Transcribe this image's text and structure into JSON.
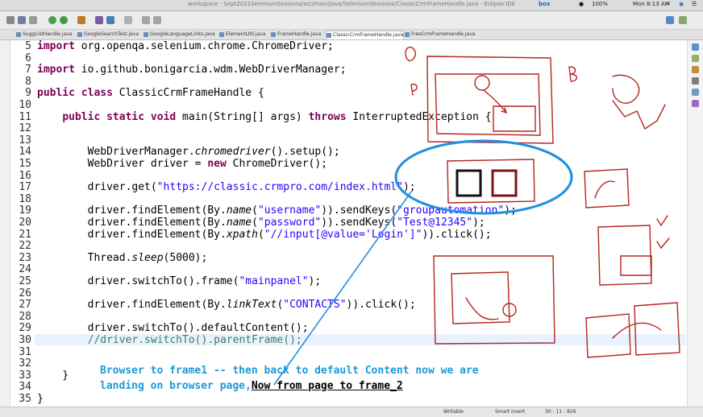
{
  "window": {
    "title": "workspace - Sept2021SeleniumSessions/src/main/java/SeleniumSessions/ClassicCrmFrameHandle.java - Eclipse IDE",
    "clock": "Mon 8:13 AM",
    "battery": "100%",
    "tray_app": "box"
  },
  "tabs": [
    {
      "label": "SuggListHandle.java"
    },
    {
      "label": "GoogleSearchTest.java"
    },
    {
      "label": "GoogleLanguageLinks.java"
    },
    {
      "label": "ElementUtil.java"
    },
    {
      "label": "FrameHandle.java"
    },
    {
      "label": "ClassicCrmFrameHandle.java",
      "active": true
    },
    {
      "label": "FreeCrmFrameHandle.java"
    }
  ],
  "code_lines": [
    {
      "n": "5",
      "text": "import org.openqa.selenium.chrome.ChromeDriver;"
    },
    {
      "n": "6",
      "text": ""
    },
    {
      "n": "7",
      "text": "import io.github.bonigarcia.wdm.WebDriverManager;"
    },
    {
      "n": "8",
      "text": ""
    },
    {
      "n": "9",
      "text": "public class ClassicCrmFrameHandle {"
    },
    {
      "n": "10",
      "text": ""
    },
    {
      "n": "11",
      "text": "    public static void main(String[] args) throws InterruptedException {"
    },
    {
      "n": "12",
      "text": ""
    },
    {
      "n": "13",
      "text": ""
    },
    {
      "n": "14",
      "text": "        WebDriverManager.chromedriver().setup();"
    },
    {
      "n": "15",
      "text": "        WebDriver driver = new ChromeDriver();"
    },
    {
      "n": "16",
      "text": ""
    },
    {
      "n": "17",
      "text": "        driver.get(\"https://classic.crmpro.com/index.html\");"
    },
    {
      "n": "18",
      "text": ""
    },
    {
      "n": "19",
      "text": "        driver.findElement(By.name(\"username\")).sendKeys(\"groupautomation\");"
    },
    {
      "n": "20",
      "text": "        driver.findElement(By.name(\"password\")).sendKeys(\"Test@12345\");"
    },
    {
      "n": "21",
      "text": "        driver.findElement(By.xpath(\"//input[@value='Login']\")).click();"
    },
    {
      "n": "22",
      "text": ""
    },
    {
      "n": "23",
      "text": "        Thread.sleep(5000);"
    },
    {
      "n": "24",
      "text": ""
    },
    {
      "n": "25",
      "text": "        driver.switchTo().frame(\"mainpanel\");"
    },
    {
      "n": "26",
      "text": ""
    },
    {
      "n": "27",
      "text": "        driver.findElement(By.linkText(\"CONTACTS\")).click();"
    },
    {
      "n": "28",
      "text": ""
    },
    {
      "n": "29",
      "text": "        driver.switchTo().defaultContent();"
    },
    {
      "n": "30",
      "text": "        //driver.switchTo().parentFrame();"
    },
    {
      "n": "31",
      "text": ""
    },
    {
      "n": "32",
      "text": ""
    },
    {
      "n": "33",
      "text": "    }"
    },
    {
      "n": "34",
      "text": ""
    },
    {
      "n": "35",
      "text": "}"
    }
  ],
  "annotation": {
    "line1": "Browser to frame1 -- then back to default Content now we are",
    "line2_prefix": "landing on browser page,",
    "line2_underlined": "Now from page to frame_2"
  },
  "status": {
    "mode": "Writable",
    "insert": "Smart Insert",
    "position": "30 : 11 : 826"
  },
  "colors": {
    "keyword": "#7f0055",
    "string": "#2a00ff",
    "comment": "#3f7f5f",
    "annotation_blue": "#1e9ad6",
    "ink_red": "#b3261e",
    "ellipse_blue": "#1f8fe0"
  }
}
